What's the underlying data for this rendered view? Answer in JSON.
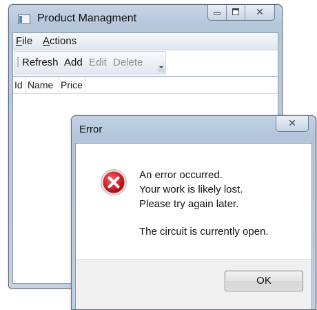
{
  "main_window": {
    "title": "Product Managment",
    "menu": [
      "File",
      "Actions"
    ],
    "toolbar": {
      "refresh": "Refresh",
      "add": "Add",
      "edit": "Edit",
      "delete": "Delete"
    },
    "grid_columns": [
      "Id",
      "Name",
      "Price"
    ],
    "caption_close_glyph": "✕"
  },
  "dialog": {
    "title": "Error",
    "close_glyph": "✕",
    "icon": "error-icon",
    "message_lines": [
      "An error occurred.",
      "Your work is likely lost.",
      "Please try again later."
    ],
    "detail": "The circuit is currently open.",
    "ok_label": "OK"
  },
  "colors": {
    "title_bar": "#b8c9dc",
    "error_red": "#d0252b",
    "disabled_text": "#8f8f8f"
  }
}
